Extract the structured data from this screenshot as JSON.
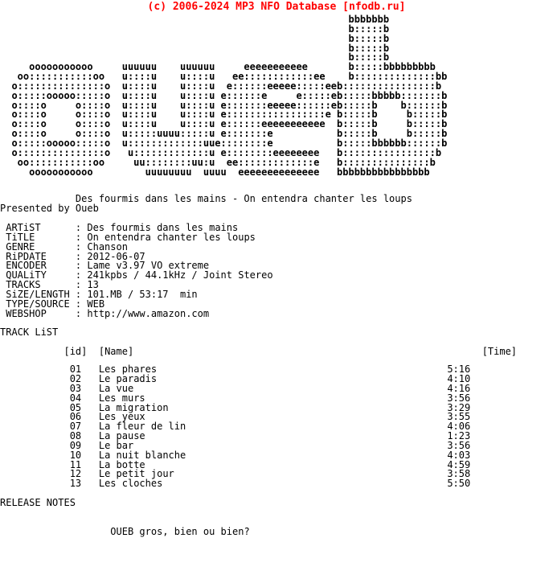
{
  "header": {
    "banner": "(c) 2006-2024 MP3 NFO Database [nfodb.ru]",
    "color": "#ff0000"
  },
  "logo": {
    "alt_text": "OUEB",
    "ascii": "                                                            bbbbbbb\n                                                            b:::::b\n                                                            b:::::b\n                                                            b:::::b\n                                                            b:::::b\n     ooooooooooo     uuuuuu    uuuuuu     eeeeeeeeeee       b:::::bbbbbbbbb\n   oo:::::::::::oo   u::::u    u::::u   ee::::::::::::ee    b::::::::::::::bb\n  o:::::::::::::::o  u::::u    u::::u  e::::::eeeee:::::eeb::::::::::::::::b\n  o:::::ooooo:::::o  u::::u    u::::u e::::::e     e:::::eb:::::bbbbb:::::::b\n  o::::o     o::::o  u::::u    u::::u e:::::::eeeee::::::eb:::::b    b::::::b\n  o::::o     o::::o  u::::u    u::::u e:::::::::::::::::e b:::::b     b:::::b\n  o::::o     o::::o  u::::u    u::::u e::::::eeeeeeeeeee  b:::::b     b:::::b\n  o::::o     o::::o  u:::::uuuu:::::u e:::::::e           b:::::b     b:::::b\n  o:::::ooooo:::::o  u:::::::::::::uue::::::::e           b:::::bbbbbb::::::b\n  o:::::::::::::::o   u:::::::::::::u e::::::::eeeeeeee   b::::::::::::::::b\n   oo:::::::::::oo     uu::::::::uu:u  ee:::::::::::::e   b:::::::::::::::b\n     ooooooooooo         uuuuuuuu  uuuu  eeeeeeeeeeeeee   bbbbbbbbbbbbbbbb"
  },
  "release": {
    "headline": "Des fourmis dans les mains - On entendra chanter les loups",
    "presented_by": "Presented by Oueb"
  },
  "info": {
    "fields": [
      {
        "label": "ARTiST",
        "value": "Des fourmis dans les mains"
      },
      {
        "label": "TiTLE",
        "value": "On entendra chanter les loups"
      },
      {
        "label": "GENRE",
        "value": "Chanson"
      },
      {
        "label": "RiPDATE",
        "value": "2012-06-07"
      },
      {
        "label": "ENCODER",
        "value": "Lame v3.97 VO extreme"
      },
      {
        "label": "QUALiTY",
        "value": "241kpbs / 44.1kHz / Joint Stereo"
      },
      {
        "label": "TRACKS",
        "value": "13"
      },
      {
        "label": "SiZE/LENGTH",
        "value": "101.MB / 53:17  min"
      },
      {
        "label": "TYPE/SOURCE",
        "value": "WEB"
      },
      {
        "label": "WEBSHOP",
        "value": "http://www.amazon.com"
      }
    ]
  },
  "tracklist": {
    "section_title": "TRACK LiST",
    "col_id": "[id]",
    "col_name": "[Name]",
    "col_time": "[Time]",
    "tracks": [
      {
        "id": "01",
        "name": "Les phares",
        "time": "5:16"
      },
      {
        "id": "02",
        "name": "Le paradis",
        "time": "4:10"
      },
      {
        "id": "03",
        "name": "La vue",
        "time": "4:16"
      },
      {
        "id": "04",
        "name": "Les murs",
        "time": "3:56"
      },
      {
        "id": "05",
        "name": "La migration",
        "time": "3:29"
      },
      {
        "id": "06",
        "name": "Les yeux",
        "time": "3:55"
      },
      {
        "id": "07",
        "name": "La fleur de lin",
        "time": "4:06"
      },
      {
        "id": "08",
        "name": "La pause",
        "time": "1:23"
      },
      {
        "id": "09",
        "name": "Le bar",
        "time": "3:56"
      },
      {
        "id": "10",
        "name": "La nuit blanche",
        "time": "4:03"
      },
      {
        "id": "11",
        "name": "La botte",
        "time": "4:59"
      },
      {
        "id": "12",
        "name": "Le petit jour",
        "time": "3:58"
      },
      {
        "id": "13",
        "name": "Les cloches",
        "time": "5:50"
      }
    ]
  },
  "notes": {
    "section_title": "RELEASE NOTES",
    "body": "OUEB gros, bien ou bien?"
  }
}
